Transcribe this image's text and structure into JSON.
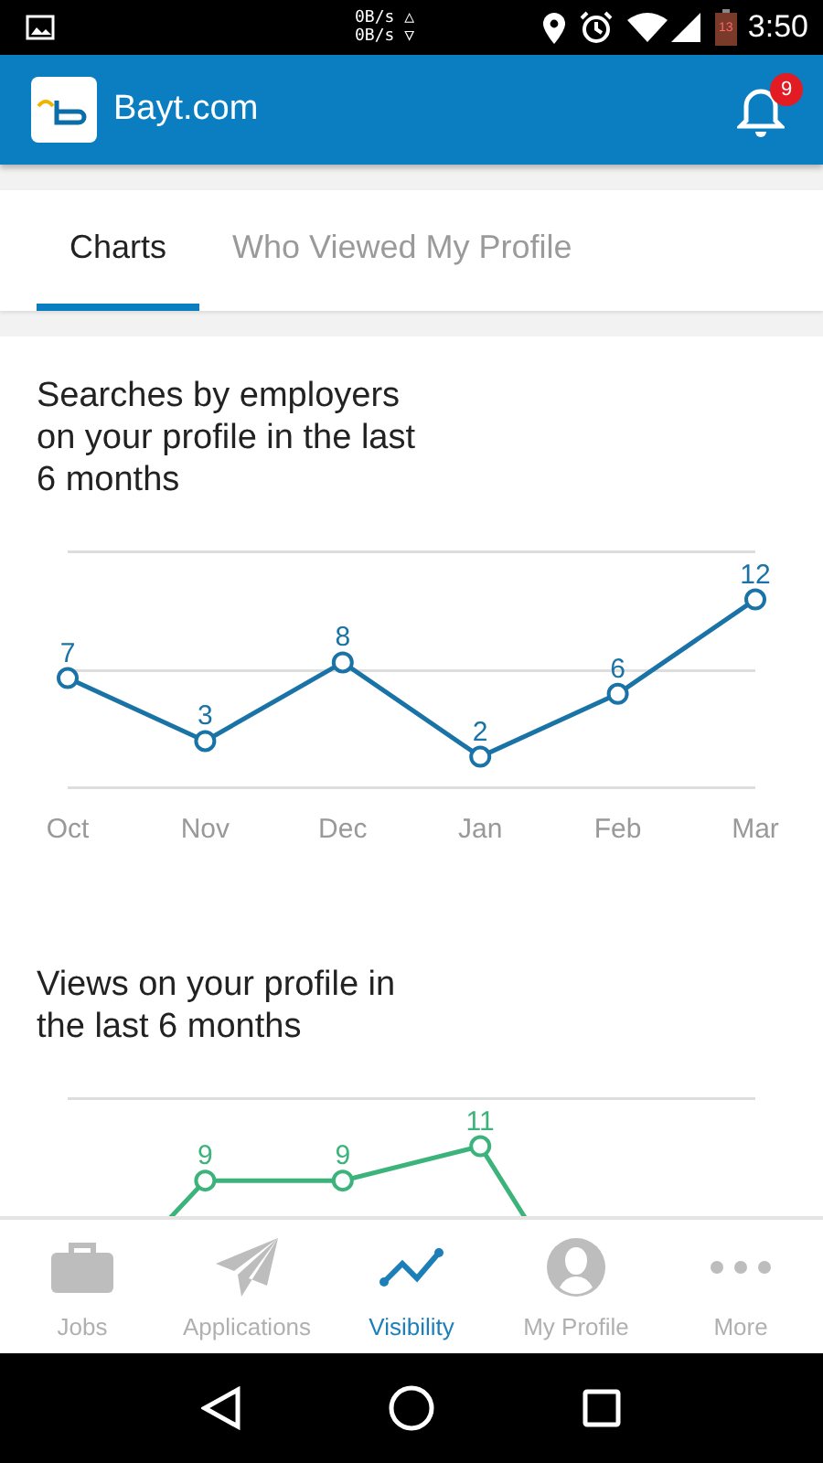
{
  "status_bar": {
    "upload": "0B/s △",
    "download": "0B/s ▽",
    "battery": "13",
    "time": "3:50"
  },
  "app_bar": {
    "title": "Bayt.com",
    "notification_count": "9"
  },
  "tabs": [
    {
      "label": "Charts",
      "selected": true
    },
    {
      "label": "Who Viewed My Profile",
      "selected": false
    }
  ],
  "charts": [
    {
      "title": "Searches by employers on your profile in the last 6 months",
      "chart_data": {
        "type": "line",
        "categories": [
          "Oct",
          "Nov",
          "Dec",
          "Jan",
          "Feb",
          "Mar"
        ],
        "data_labels": true,
        "series": [
          {
            "color": "#1a73a6",
            "marker": "circle",
            "values": [
              7,
              3,
              8,
              2,
              6,
              12
            ]
          }
        ]
      }
    },
    {
      "title": "Views on your profile in the last 6 months",
      "chart_data": {
        "type": "line",
        "data_labels": true,
        "series": [
          {
            "color": "#3bb37a",
            "marker": "circle",
            "values": [
              null,
              9,
              9,
              11,
              null,
              null
            ]
          }
        ]
      }
    }
  ],
  "bottom_nav": [
    {
      "kind": "jobs",
      "label": "Jobs",
      "selected": false
    },
    {
      "kind": "applications",
      "label": "Applications",
      "selected": false
    },
    {
      "kind": "visibility",
      "label": "Visibility",
      "selected": true
    },
    {
      "kind": "profile",
      "label": "My Profile",
      "selected": false
    },
    {
      "kind": "more",
      "label": "More",
      "selected": false
    }
  ]
}
